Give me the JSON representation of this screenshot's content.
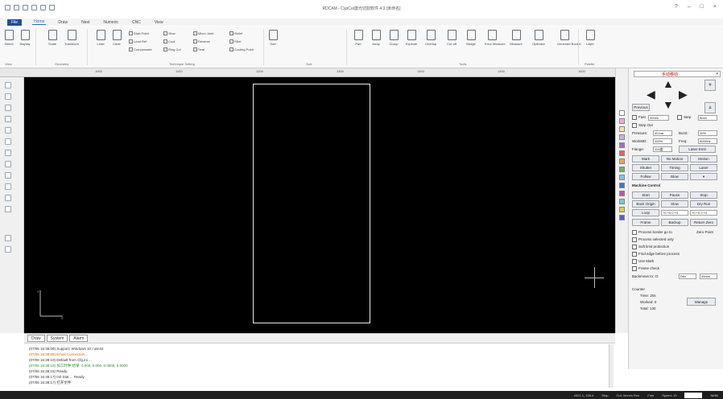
{
  "window": {
    "title": "RDCAM - CypCut激光切割软件 4.3 [未命名]",
    "controls": [
      "?",
      "–",
      "□",
      "×"
    ]
  },
  "menu": [
    "File",
    "Home",
    "Draw",
    "Nest",
    "Numeric",
    "CNC",
    "View"
  ],
  "ribbon": {
    "buttons": [
      {
        "label": "Select"
      },
      {
        "label": "Display"
      },
      {
        "label": "Scale"
      },
      {
        "label": "Transform"
      },
      {
        "label": "Lead"
      },
      {
        "label": "Clear"
      },
      {
        "label": "Sort"
      },
      {
        "label": "Part"
      },
      {
        "label": "Array"
      },
      {
        "label": "Group"
      },
      {
        "label": "Explode"
      },
      {
        "label": "Overlap"
      },
      {
        "label": "Cut-off"
      },
      {
        "label": "Bridge"
      },
      {
        "label": "Error Measure"
      },
      {
        "label": "Measure"
      },
      {
        "label": "Optimize"
      },
      {
        "label": "Generate Border"
      },
      {
        "label": "Layer"
      }
    ],
    "options": [
      "Start Point",
      "Slow",
      "Micro Joint",
      "Relief",
      "Lead Ref",
      "Cool",
      "Reverse",
      "Fillet",
      "Compensate",
      "Ring Cut",
      "Seal",
      "Cooling Point"
    ],
    "groups": [
      "View",
      "Geometry",
      "Technique Setting",
      "Sort",
      "Tools",
      "Palette"
    ]
  },
  "ruler": [
    "1000",
    "1100",
    "1200",
    "1300",
    "1400",
    "1500",
    "1600"
  ],
  "right_panel": {
    "dropdown": "手动移动",
    "previous": "Previous",
    "fast": "Fast",
    "fast_speed": "30m/s",
    "step": "Step",
    "step_val": "5mm",
    "step_out": "Step Out",
    "pressure": "Pressure:",
    "pressure_val": "40 bar",
    "burst": "Burst:",
    "burst_val": "10%",
    "workmd": "WorkMD:",
    "workmd_val": "100%",
    "freq": "Freq:",
    "freq_val": "5000Hz",
    "flange": "Flange:",
    "flange_val": "100度",
    "laser_emit": "Laser Emit",
    "mark": "Mark",
    "no_motion": "No Motion",
    "alt_motion": "Motion",
    "shutter": "Shutter",
    "timing": "Timing",
    "laser": "Laser",
    "follow": "Follow",
    "blow": "Blow",
    "machine_control": "Machine Control",
    "start": "Start",
    "pause": "Pause",
    "stop": "Stop",
    "back_to_origin": "Back Origin",
    "slow": "Slow",
    "dry_run": "Dry Run",
    "loop": "Loop",
    "coord1": "+0 +0.0 +0",
    "coord2": "+0 +0.0 +0",
    "frame": "Frame",
    "backup": "Backup",
    "return_zero": "Return Zero",
    "opts": [
      "Process border go to",
      "Process selected only",
      "Soft limit protection",
      "Find edge before process",
      "Use Mark",
      "Frame check"
    ],
    "zero_point": "Zero Point",
    "backmove_lbl": "Backmove to: O:",
    "backmove_sel": "Dec",
    "backmove_speed": "30m/s",
    "counter": "Counter",
    "time": "Time: 20s",
    "worked": "Worked: 0",
    "total": "Total: 130",
    "manage": "Manage"
  },
  "bottom_tabs": [
    "Draw",
    "System",
    "Alarm"
  ],
  "log": [
    "(07/06 16:38:09) Support: Windows 10 / win32",
    "(07/06 16:38:09) Email Connection...",
    "(07/06 16:38:10) Default from Cfg.ini ...",
    "(07/06 16:38:10) 加工时钟 结果: 0.000, 0.000, 0.0000, 0.0000",
    "(07/06 16:38:15) Ready.",
    "(07/06 16:38:17) Init Stat ... Ready.",
    "(07/06 16:38:17) 打开文件"
  ],
  "status": {
    "coords": "4321.1, 336.4",
    "state": "Stop",
    "pos": "Cut: 0mm/s  Run",
    "field": "Fine",
    "spd": "Speed: 10",
    "end": "NMM"
  },
  "colors": {
    "canvas": "#000000",
    "file_tab": "#1d4f9b",
    "status_bar": "#1e1e1e"
  }
}
